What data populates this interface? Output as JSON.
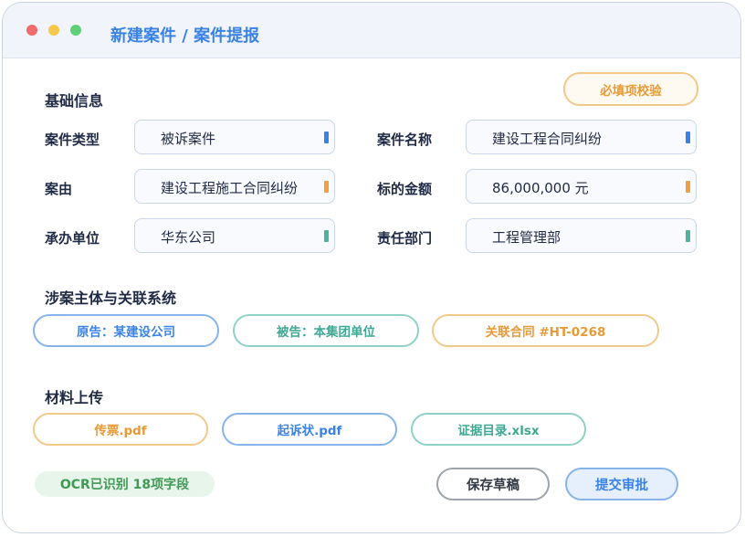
{
  "window": {
    "title": "新建案件 / 案件提报"
  },
  "colors": {
    "accent": "#3b82e6",
    "teal": "#3fa894",
    "orange": "#e89a36",
    "ocr_green": "#3f9a55"
  },
  "basic_info": {
    "section_title": "基础信息",
    "validate_label": "必填项校验",
    "fields": {
      "case_type": {
        "label": "案件类型",
        "value": "被诉案件",
        "marker_color": "#3b82e6"
      },
      "case_name": {
        "label": "案件名称",
        "value": "建设工程合同纠纷",
        "marker_color": "#3b82e6"
      },
      "cause": {
        "label": "案由",
        "value": "建设工程施工合同纠纷",
        "marker_color": "#f0a040"
      },
      "amount": {
        "label": "标的金额",
        "value": "86,000,000 元",
        "marker_color": "#f0a040"
      },
      "unit": {
        "label": "承办单位",
        "value": "华东公司",
        "marker_color": "#4fb39c"
      },
      "department": {
        "label": "责任部门",
        "value": "工程管理部",
        "marker_color": "#4fb39c"
      }
    }
  },
  "parties": {
    "section_title": "涉案主体与关联系统",
    "plaintiff": "原告：某建设公司",
    "defendant": "被告：本集团单位",
    "contract": "关联合同 #HT-0268"
  },
  "materials": {
    "section_title": "材料上传",
    "files": {
      "summons": "传票.pdf",
      "complaint": "起诉状.pdf",
      "evidence": "证据目录.xlsx"
    }
  },
  "footer": {
    "ocr_status": "OCR已识别 18项字段",
    "save_draft_label": "保存草稿",
    "submit_label": "提交审批"
  }
}
